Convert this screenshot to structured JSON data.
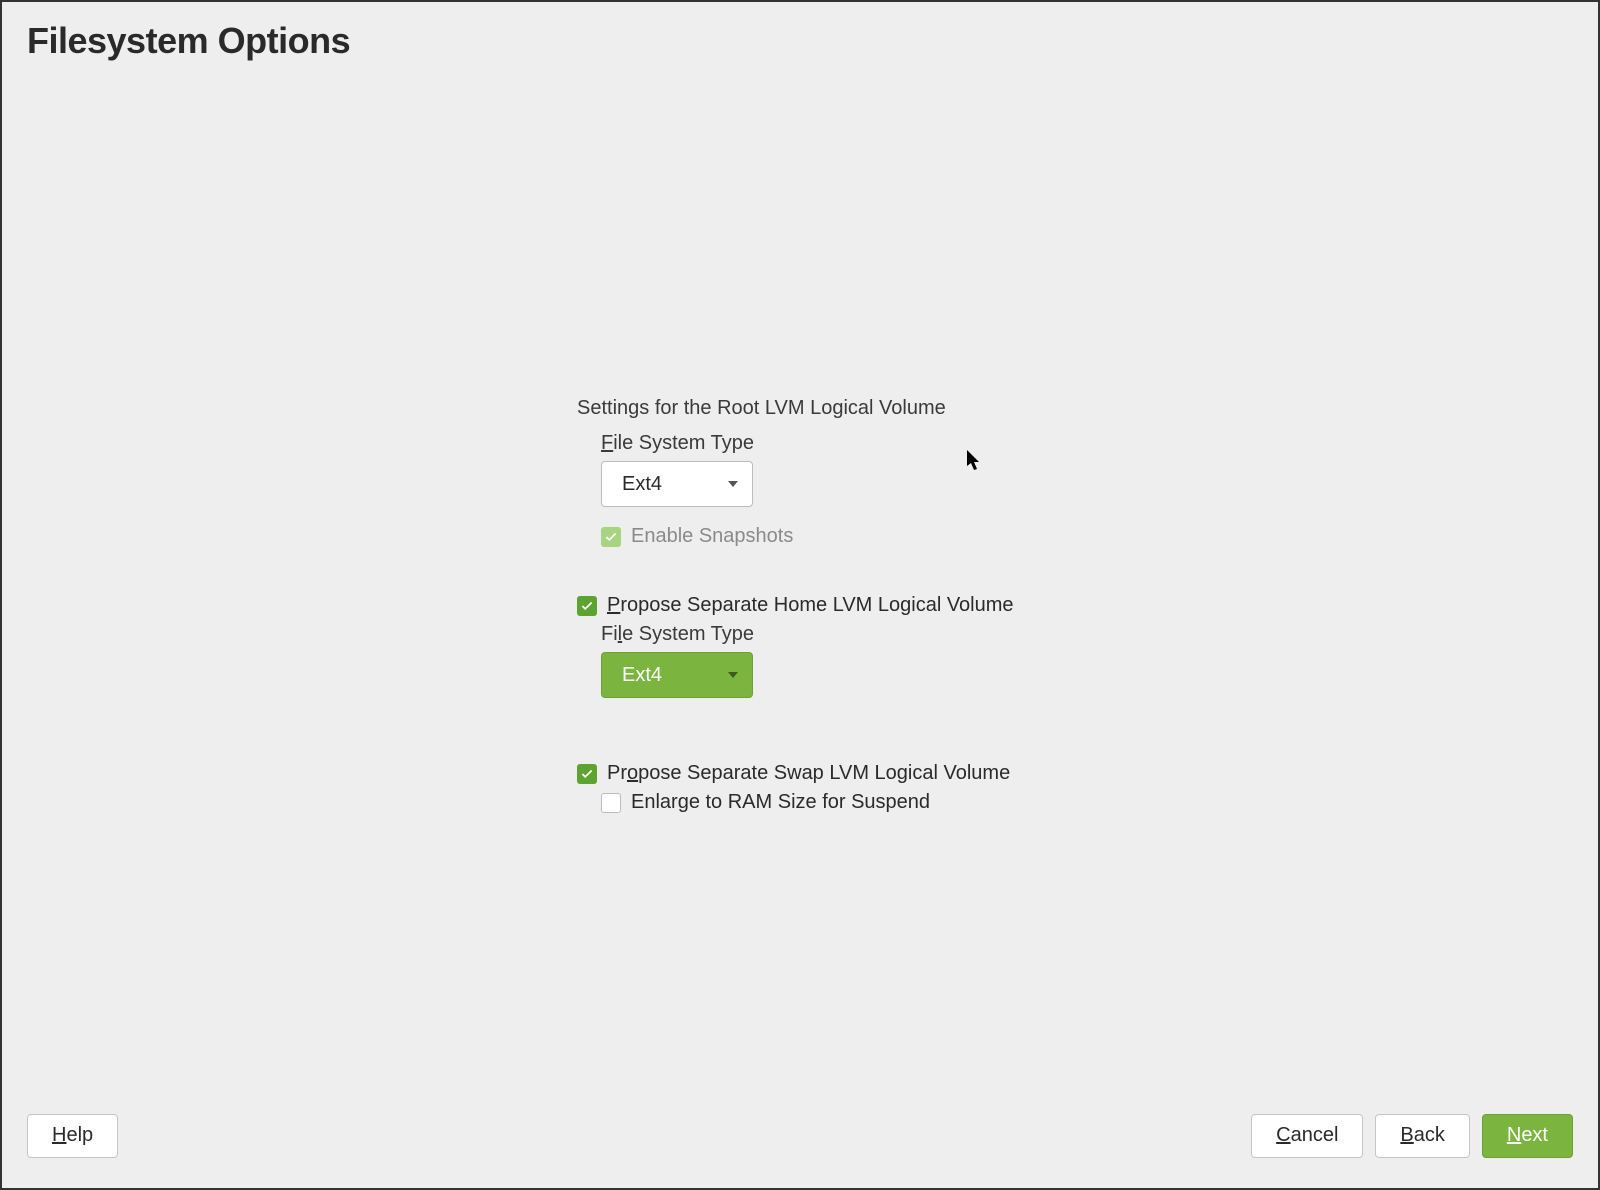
{
  "header": {
    "title": "Filesystem Options"
  },
  "root_section": {
    "heading": "Settings for the Root LVM Logical Volume",
    "fs_label_pre": "F",
    "fs_label_rest": "ile System Type",
    "fs_value": "Ext4",
    "snapshots_label": "Enable Snapshots",
    "snapshots_checked": true,
    "snapshots_disabled": true
  },
  "home_section": {
    "checkbox_pre": "P",
    "checkbox_rest": "ropose Separate Home LVM Logical Volume",
    "checked": true,
    "fs_label_pre": "Fi",
    "fs_label_under": "l",
    "fs_label_rest": "e System Type",
    "fs_value": "Ext4"
  },
  "swap_section": {
    "checkbox_pre": "Pr",
    "checkbox_under": "o",
    "checkbox_rest": "pose Separate Swap LVM Logical Volume",
    "checked": true,
    "enlarge_label": "Enlarge to RAM Size for Suspend",
    "enlarge_checked": false
  },
  "footer": {
    "help_under": "H",
    "help_rest": "elp",
    "cancel_under": "C",
    "cancel_rest": "ancel",
    "back_under": "B",
    "back_rest": "ack",
    "next_under": "N",
    "next_rest": "ext"
  }
}
